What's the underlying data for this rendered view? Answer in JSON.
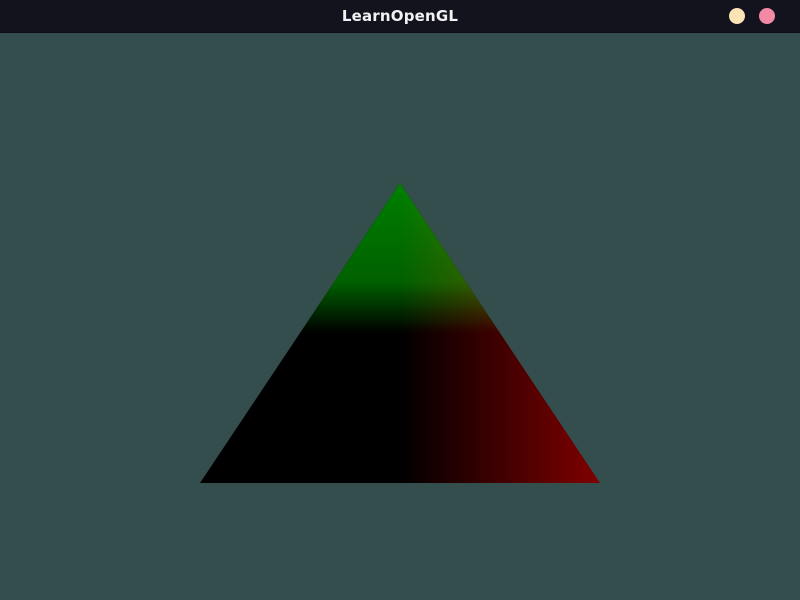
{
  "window": {
    "title": "LearnOpenGL"
  },
  "titlebar": {
    "minimize_color": "#fbe3b6",
    "close_color": "#f28aa5"
  },
  "scene": {
    "clear_color": "#344d4d",
    "vertex_colors": {
      "top": "#008000",
      "bottom_left": "#000000",
      "bottom_right": "#800000"
    }
  }
}
